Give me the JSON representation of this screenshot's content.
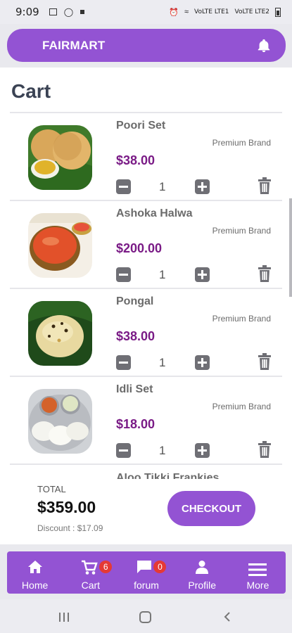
{
  "status_bar": {
    "time": "9:09",
    "signal_text_1": "VoLTE LTE1",
    "signal_text_2": "VoLTE LTE2"
  },
  "header": {
    "brand": "FAIRMART"
  },
  "page": {
    "title": "Cart"
  },
  "items": [
    {
      "name": "Poori Set",
      "tag": "Premium Brand",
      "price": "$38.00",
      "qty": "1"
    },
    {
      "name": "Ashoka Halwa",
      "tag": "Premium Brand",
      "price": "$200.00",
      "qty": "1"
    },
    {
      "name": "Pongal",
      "tag": "Premium Brand",
      "price": "$38.00",
      "qty": "1"
    },
    {
      "name": "Idli Set",
      "tag": "Premium Brand",
      "price": "$18.00",
      "qty": "1"
    }
  ],
  "peek_item": {
    "name": "Aloo Tikki Frankies"
  },
  "summary": {
    "total_label": "TOTAL",
    "total_value": "$359.00",
    "discount": "Discount : $17.09",
    "checkout_label": "CHECKOUT"
  },
  "bottom_nav": [
    {
      "label": "Home",
      "icon": "home-icon"
    },
    {
      "label": "Cart",
      "icon": "cart-icon",
      "badge": "6"
    },
    {
      "label": "forum",
      "icon": "chat-icon",
      "badge": "0"
    },
    {
      "label": "Profile",
      "icon": "person-icon"
    },
    {
      "label": "More",
      "icon": "menu-icon"
    }
  ],
  "colors": {
    "primary": "#9353d3",
    "price": "#7a1b86",
    "badge": "#e53935"
  }
}
